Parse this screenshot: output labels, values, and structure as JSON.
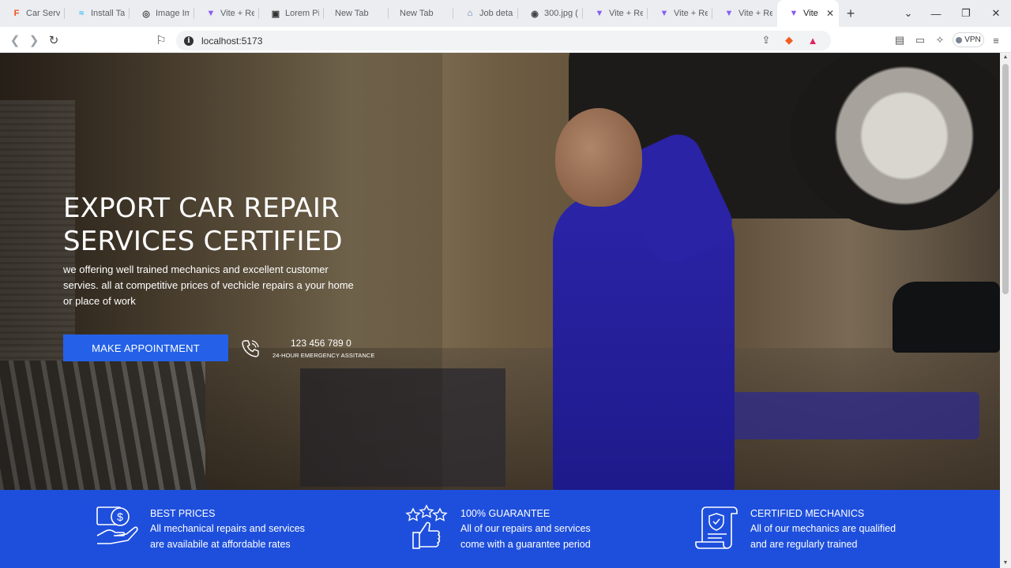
{
  "browser": {
    "tabs": [
      {
        "label": "Car Servic",
        "icon": "figma-icon",
        "active": false
      },
      {
        "label": "Install Tai",
        "icon": "tailwind-icon",
        "active": false
      },
      {
        "label": "Image Im",
        "icon": "globe-icon",
        "active": false
      },
      {
        "label": "Vite + Re",
        "icon": "vite-icon",
        "active": false
      },
      {
        "label": "Lorem Pi",
        "icon": "image-icon",
        "active": false
      },
      {
        "label": "New Tab",
        "icon": "",
        "active": false
      },
      {
        "label": "New Tab",
        "icon": "",
        "active": false
      },
      {
        "label": "Job detai",
        "icon": "briefcase-icon",
        "active": false
      },
      {
        "label": "300.jpg (",
        "icon": "globe-icon",
        "active": false
      },
      {
        "label": "Vite + Re",
        "icon": "vite-icon",
        "active": false
      },
      {
        "label": "Vite + Re",
        "icon": "vite-icon",
        "active": false
      },
      {
        "label": "Vite + Re",
        "icon": "vite-icon",
        "active": false
      },
      {
        "label": "Vite",
        "icon": "vite-icon",
        "active": true
      }
    ],
    "url": "localhost:5173",
    "vpn_label": "VPN"
  },
  "hero": {
    "title_line1": "EXPORT CAR REPAIR",
    "title_line2": "SERVICES CERTIFIED",
    "description": "we offering well trained mechanics and excellent customer servies. all at competitive prices of vechicle repairs a your home or place of work",
    "cta_label": "MAKE APPOINTMENT",
    "phone_number": "123 456 789 0",
    "phone_caption": "24-HOUR EMERGENCY ASSITANCE"
  },
  "features": [
    {
      "icon": "money-hand-icon",
      "title": "BEST PRICES",
      "desc_line1": "All mechanical repairs and services",
      "desc_line2": "are availabile at affordable rates"
    },
    {
      "icon": "thumbs-up-stars-icon",
      "title": "100% GUARANTEE",
      "desc_line1": "All of our repairs and services",
      "desc_line2": "come with a guarantee period"
    },
    {
      "icon": "certificate-icon",
      "title": "CERTIFIED MECHANICS",
      "desc_line1": "All of our mechanics are qualified",
      "desc_line2": "and are regularly trained"
    }
  ],
  "colors": {
    "accent": "#2461e8",
    "features_bg": "#1e4fdc",
    "text_light": "#ffffff"
  }
}
